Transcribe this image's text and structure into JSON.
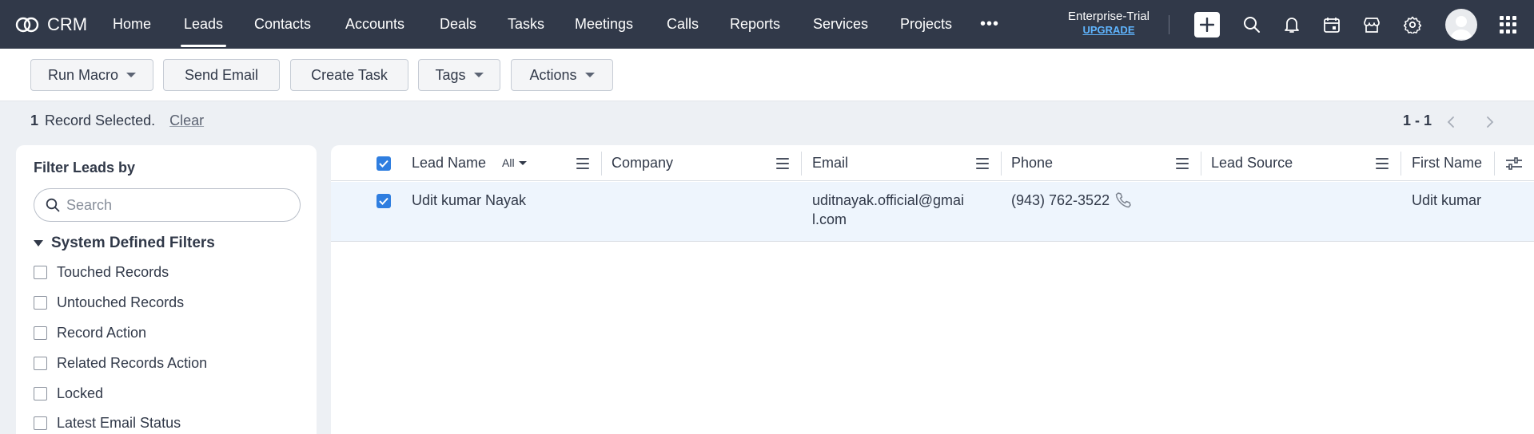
{
  "app": {
    "name": "CRM"
  },
  "nav": {
    "items": [
      {
        "label": "Home"
      },
      {
        "label": "Leads",
        "active": true
      },
      {
        "label": "Contacts"
      },
      {
        "label": "Accounts"
      },
      {
        "label": "Deals"
      },
      {
        "label": "Tasks"
      },
      {
        "label": "Meetings"
      },
      {
        "label": "Calls"
      },
      {
        "label": "Reports"
      },
      {
        "label": "Services"
      },
      {
        "label": "Projects"
      }
    ],
    "more": "•••",
    "plan": "Enterprise-Trial",
    "upgrade": "UPGRADE",
    "icons": [
      "plus-icon",
      "search-icon",
      "bell-icon",
      "calendar-icon",
      "marketplace-icon",
      "gear-icon",
      "avatar",
      "apps-grid-icon"
    ]
  },
  "toolbar": {
    "run_macro": "Run Macro",
    "send_email": "Send Email",
    "create_task": "Create Task",
    "tags": "Tags",
    "actions": "Actions"
  },
  "selection": {
    "count": "1",
    "text": "Record Selected.",
    "clear": "Clear"
  },
  "pagination": {
    "range": "1 - 1"
  },
  "filters": {
    "title": "Filter Leads by",
    "search_placeholder": "Search",
    "section": "System Defined Filters",
    "items": [
      "Touched Records",
      "Untouched Records",
      "Record Action",
      "Related Records Action",
      "Locked",
      "Latest Email Status"
    ]
  },
  "table": {
    "columns": [
      "Lead Name",
      "Company",
      "Email",
      "Phone",
      "Lead Source",
      "First Name"
    ],
    "lead_name_filter": "All",
    "rows": [
      {
        "lead_name": "Udit kumar Nayak",
        "company": "",
        "email_line1": "uditnayak.official@gmai",
        "email_line2": "l.com",
        "phone": "(943) 762-3522",
        "lead_source": "",
        "first_name": "Udit kumar",
        "selected": true
      }
    ]
  },
  "colors": {
    "nav_bg": "#313949",
    "accent": "#2f7ee0",
    "upgrade_link": "#5fb5ff",
    "selected_row": "#eef5fd"
  }
}
